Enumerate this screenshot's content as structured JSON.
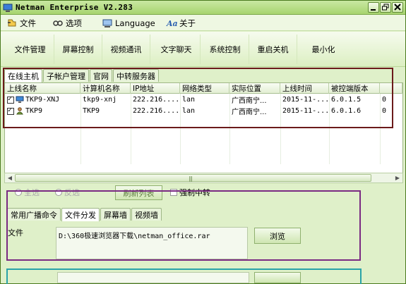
{
  "titlebar": {
    "title": "Netman Enterprise V2.283"
  },
  "menu": {
    "items": [
      {
        "label": "文件",
        "icon": "file-menu-icon"
      },
      {
        "label": "选项",
        "icon": "options-menu-icon"
      },
      {
        "label": "Language",
        "icon": "language-menu-icon"
      },
      {
        "label": "关于",
        "icon": "about-menu-icon"
      }
    ]
  },
  "toolbar": {
    "buttons": [
      "文件管理",
      "屏幕控制",
      "视频通讯",
      "文字聊天",
      "系统控制",
      "重启关机",
      "最小化"
    ]
  },
  "tabs_top": [
    "在线主机",
    "子帐户管理",
    "官网",
    "中转服务器"
  ],
  "table": {
    "columns": [
      "上线名称",
      "计算机名称",
      "IP地址",
      "网络类型",
      "实际位置",
      "上线时间",
      "被控端版本",
      ""
    ],
    "rows": [
      {
        "name": "TKP9-XNJ",
        "computer": "tkp9-xnj",
        "ip": "222.216....",
        "net": "lan",
        "location": "广西南宁...",
        "time": "2015-11-...",
        "version": "6.0.1.5",
        "extra": "0"
      },
      {
        "name": "TKP9",
        "computer": "TKP9",
        "ip": "222.216....",
        "net": "lan",
        "location": "广西南宁...",
        "time": "2015-11-...",
        "version": "6.0.1.6",
        "extra": "0"
      }
    ]
  },
  "controls": {
    "select_all": "全选",
    "invert": "反选",
    "refresh": "刷新列表",
    "force_relay": "强制中转"
  },
  "tabs_bottom": [
    "常用广播命令",
    "文件分发",
    "屏幕墙",
    "视频墙"
  ],
  "file_field": {
    "label": "文件",
    "value": "D:\\360极速浏览器下载\\netman_office.rar",
    "browse": "浏览"
  }
}
